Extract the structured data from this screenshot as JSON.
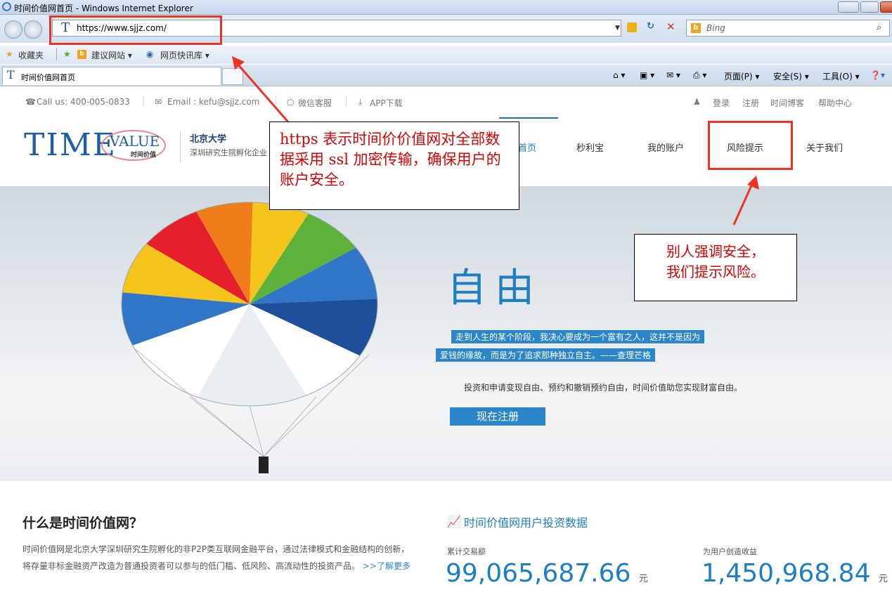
{
  "window": {
    "title": "时间价值网首页 - Windows Internet Explorer"
  },
  "address": {
    "url": "https://www.sjjz.com/",
    "search_placeholder": "Bing"
  },
  "favorites": {
    "label": "收藏夹",
    "suggested": "建议网站 ▾",
    "webslice": "网页快讯库 ▾"
  },
  "tab": {
    "title": "时间价值网首页"
  },
  "commands": {
    "page": "页面(P) ▾",
    "safety": "安全(S) ▾",
    "tools": "工具(O) ▾"
  },
  "topbar": {
    "phone": "Call us: 400-005-0833",
    "email": "Email : kefu@sjjz.com",
    "wechat": "微信客服",
    "app": "APP下载",
    "login": "登录",
    "register": "注册",
    "blog": "时间博客",
    "help": "帮助中心"
  },
  "logo": {
    "time": "TIME",
    "value": "VALUE",
    "value_sub": "时间价值",
    "pku": "北京大学",
    "pku_sub": "深圳研究生院孵化企业"
  },
  "nav": [
    {
      "label": "首页"
    },
    {
      "label": "秒利宝"
    },
    {
      "label": "我的账户"
    },
    {
      "label": "风险提示"
    },
    {
      "label": "关于我们"
    }
  ],
  "hero": {
    "headline": "自由",
    "quote_line1": "走到人生的某个阶段，我决心要成为一个富有之人，这并不是因为",
    "quote_line2": "爱钱的缘故，而是为了追求那种独立自主。——查理芒格",
    "sub": "投资和申请变现自由、预约和撤销预约自由，时间价值助您实现财富自由。",
    "cta": "现在注册"
  },
  "annotations": {
    "https_note": "https 表示时间价价值网对全部数据采用 ssl 加密传输，确保用户的账户安全。",
    "risk_note_line1": "别人强调安全，",
    "risk_note_line2": "我们提示风险。"
  },
  "about": {
    "title": "什么是时间价值网？",
    "text": "时间价值网是北京大学深圳研究生院孵化的非P2P类互联网金融平台，通过法律模式和金融结构的创新，将存量非标金融资产改造为普通投资者可以参与的低门槛、低风险、高流动性的投资产品。",
    "more": ">>了解更多"
  },
  "stats": {
    "title": "时间价值网用户投资数据",
    "volume_label": "累计交易额",
    "volume_value": "99,065,687.66",
    "earnings_label": "为用户创造收益",
    "earnings_value": "1,450,968.84",
    "unit": "元"
  },
  "colors": {
    "brand_blue": "#1c7fc2",
    "annotation_red": "#e32"
  }
}
